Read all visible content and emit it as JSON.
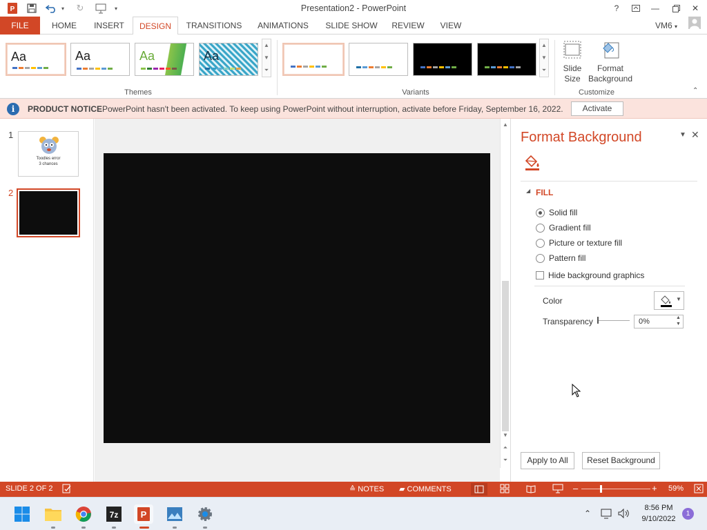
{
  "window": {
    "title": "Presentation2 - PowerPoint",
    "user": "VM6"
  },
  "tabs": [
    "FILE",
    "HOME",
    "INSERT",
    "DESIGN",
    "TRANSITIONS",
    "ANIMATIONS",
    "SLIDE SHOW",
    "REVIEW",
    "VIEW"
  ],
  "active_tab": "DESIGN",
  "ribbon": {
    "themes_label": "Themes",
    "variants_label": "Variants",
    "customize_label": "Customize",
    "theme_thumb_text": "Aa",
    "slide_size_label": "Slide Size",
    "format_background_label": "Format Background"
  },
  "notice": {
    "title": "PRODUCT NOTICE",
    "message": "PowerPoint hasn't been activated. To keep using PowerPoint without interruption, activate before Friday, September 16, 2022.",
    "button": "Activate"
  },
  "slides": [
    {
      "number": "1",
      "caption_line1": "Toodles error",
      "caption_line2": "3 chances"
    },
    {
      "number": "2"
    }
  ],
  "pane": {
    "title": "Format Background",
    "section": "FILL",
    "options": [
      {
        "label": "Solid fill",
        "selected": true
      },
      {
        "label": "Gradient fill",
        "selected": false
      },
      {
        "label": "Picture or texture fill",
        "selected": false
      },
      {
        "label": "Pattern fill",
        "selected": false
      }
    ],
    "hide_graphics_label": "Hide background graphics",
    "color_label": "Color",
    "transparency_label": "Transparency",
    "transparency_value": "0%",
    "apply_all": "Apply to All",
    "reset": "Reset Background"
  },
  "status": {
    "slide": "SLIDE 2 OF 2",
    "notes": "NOTES",
    "comments": "COMMENTS",
    "zoom": "59%"
  },
  "taskbar": {
    "time": "8:56 PM",
    "date": "9/10/2022",
    "notifications": "1"
  },
  "colors": {
    "accent": "#d24726",
    "slide_bg": "#0d0d0d"
  }
}
